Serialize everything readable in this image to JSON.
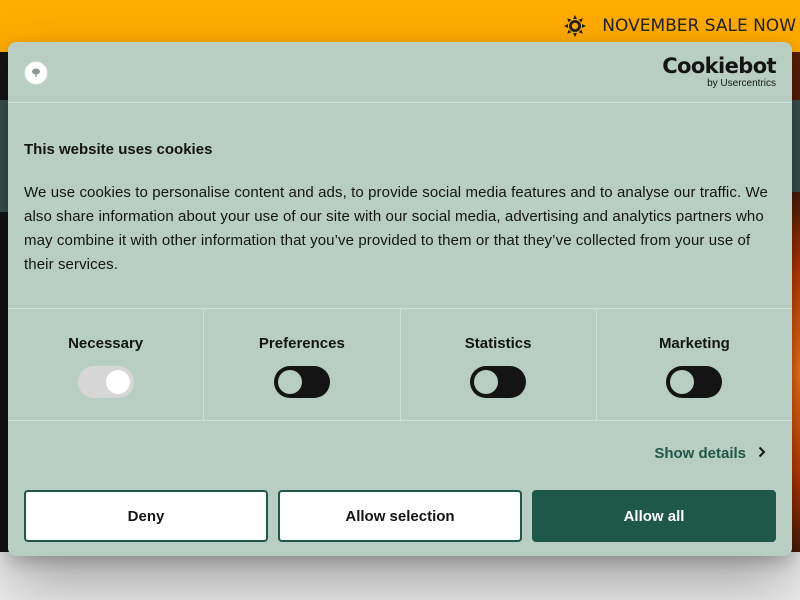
{
  "promo": {
    "text": "NOVEMBER SALE NOW",
    "icon": "sun-icon"
  },
  "dialog": {
    "site_logo_icon": "tree-logo-icon",
    "brand": {
      "name": "Cookiebot",
      "sub": "by Usercentrics"
    },
    "title": "This website uses cookies",
    "text": "We use cookies to personalise content and ads, to provide social media features and to analyse our traffic. We also share information about your use of our site with our social media, advertising and analytics partners who may combine it with other information that you’ve provided to them or that they’ve collected from your use of their services.",
    "categories": [
      {
        "label": "Necessary",
        "enabled": true
      },
      {
        "label": "Preferences",
        "enabled": false
      },
      {
        "label": "Statistics",
        "enabled": false
      },
      {
        "label": "Marketing",
        "enabled": false
      }
    ],
    "show_details": "Show details",
    "buttons": {
      "deny": "Deny",
      "allow_selection": "Allow selection",
      "allow_all": "Allow all"
    }
  },
  "colors": {
    "promo_bar": "#ffab00",
    "dialog_bg": "#b9cec2",
    "accent": "#1f5749",
    "text": "#141414"
  }
}
